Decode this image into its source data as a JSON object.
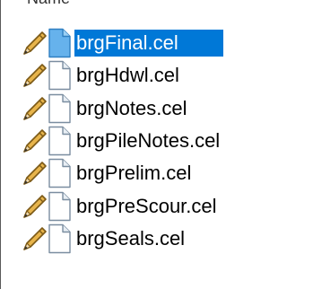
{
  "header": {
    "column_name": "Name"
  },
  "colors": {
    "selection_background": "#0078d7",
    "selection_text": "#ffffff",
    "text": "#000000",
    "selected_doc_icon": "#66b2ec"
  },
  "files": [
    {
      "name": "brgFinal.cel",
      "selected": true,
      "icon": "pencil-icon"
    },
    {
      "name": "brgHdwl.cel",
      "selected": false,
      "icon": "pencil-icon"
    },
    {
      "name": "brgNotes.cel",
      "selected": false,
      "icon": "pencil-icon"
    },
    {
      "name": "brgPileNotes.cel",
      "selected": false,
      "icon": "pencil-icon"
    },
    {
      "name": "brgPrelim.cel",
      "selected": false,
      "icon": "pencil-icon"
    },
    {
      "name": "brgPreScour.cel",
      "selected": false,
      "icon": "pencil-icon"
    },
    {
      "name": "brgSeals.cel",
      "selected": false,
      "icon": "pencil-icon"
    }
  ]
}
